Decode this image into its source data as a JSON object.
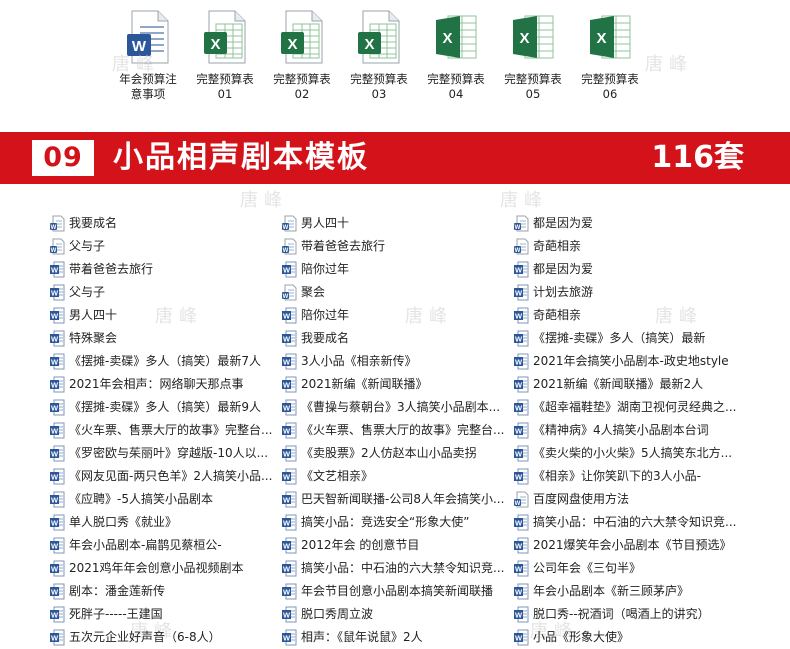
{
  "top_files": [
    {
      "label": "年会预算注\n意事项",
      "icon": "word-doc-icon"
    },
    {
      "label": "完整预算表\n01",
      "icon": "excel-old-icon"
    },
    {
      "label": "完整预算表\n02",
      "icon": "excel-old-icon"
    },
    {
      "label": "完整预算表\n03",
      "icon": "excel-old-icon"
    },
    {
      "label": "完整预算表\n04",
      "icon": "excel-new-icon"
    },
    {
      "label": "完整预算表\n05",
      "icon": "excel-new-icon"
    },
    {
      "label": "完整预算表\n06",
      "icon": "excel-new-icon"
    }
  ],
  "banner": {
    "number": "09",
    "title": "小品相声剧本模板",
    "count": "116套"
  },
  "colors": {
    "banner_red": "#d3121a",
    "word_blue": "#2b579a",
    "excel_green": "#217346"
  },
  "watermark": "唐峰",
  "columns": [
    [
      {
        "label": "我要成名",
        "icon": "word-old-icon"
      },
      {
        "label": "父与子",
        "icon": "word-old-icon"
      },
      {
        "label": "带着爸爸去旅行",
        "icon": "word-icon"
      },
      {
        "label": "父与子",
        "icon": "word-icon"
      },
      {
        "label": "男人四十",
        "icon": "word-icon"
      },
      {
        "label": "特殊聚会",
        "icon": "word-icon"
      },
      {
        "label": "《摆摊-卖碟》多人（搞笑）最新7人",
        "icon": "word-icon"
      },
      {
        "label": "2021年会相声：网络聊天那点事",
        "icon": "word-icon"
      },
      {
        "label": "《摆摊-卖碟》多人（搞笑）最新9人",
        "icon": "word-icon"
      },
      {
        "label": "《火车票、售票大厅的故事》完整台...",
        "icon": "word-icon"
      },
      {
        "label": "《罗密欧与茱丽叶》穿越版-10人以...",
        "icon": "word-icon"
      },
      {
        "label": "《网友见面-两只色羊》2人搞笑小品...",
        "icon": "word-icon"
      },
      {
        "label": "《应聘》-5人搞笑小品剧本",
        "icon": "word-icon"
      },
      {
        "label": "单人脱口秀《就业》",
        "icon": "word-icon"
      },
      {
        "label": "年会小品剧本-扁鹊见蔡桓公-",
        "icon": "word-icon"
      },
      {
        "label": "2021鸡年年会创意小品视频剧本",
        "icon": "word-icon"
      },
      {
        "label": "剧本：潘金莲新传",
        "icon": "word-icon"
      },
      {
        "label": "死胖子-----王建国",
        "icon": "word-icon"
      },
      {
        "label": "五次元企业好声音（6-8人）",
        "icon": "word-icon"
      }
    ],
    [
      {
        "label": "男人四十",
        "icon": "word-old-icon"
      },
      {
        "label": "带着爸爸去旅行",
        "icon": "word-old-icon"
      },
      {
        "label": "陪你过年",
        "icon": "word-icon"
      },
      {
        "label": "聚会",
        "icon": "word-old-icon"
      },
      {
        "label": "陪你过年",
        "icon": "word-icon"
      },
      {
        "label": "我要成名",
        "icon": "word-icon"
      },
      {
        "label": "3人小品《相亲新传》",
        "icon": "word-icon"
      },
      {
        "label": "2021新编《新闻联播》",
        "icon": "word-icon"
      },
      {
        "label": "《曹操与蔡朝台》3人搞笑小品剧本...",
        "icon": "word-icon"
      },
      {
        "label": "《火车票、售票大厅的故事》完整台...",
        "icon": "word-icon"
      },
      {
        "label": "《卖股票》2人仿赵本山小品卖拐",
        "icon": "word-icon"
      },
      {
        "label": "《文艺相亲》",
        "icon": "word-icon"
      },
      {
        "label": "巴天智新闻联播-公司8人年会搞笑小...",
        "icon": "word-icon"
      },
      {
        "label": "搞笑小品：竞选安全“形象大使”",
        "icon": "word-icon"
      },
      {
        "label": "2012年会               的创意节目",
        "icon": "word-icon"
      },
      {
        "label": "搞笑小品：中石油的六大禁令知识竞...",
        "icon": "word-icon"
      },
      {
        "label": "年会节目创意小品剧本搞笑新闻联播",
        "icon": "word-icon"
      },
      {
        "label": "脱口秀周立波",
        "icon": "word-icon"
      },
      {
        "label": "相声：《鼠年说鼠》2人",
        "icon": "word-icon"
      }
    ],
    [
      {
        "label": "都是因为爱",
        "icon": "word-old-icon"
      },
      {
        "label": "奇葩相亲",
        "icon": "word-old-icon"
      },
      {
        "label": "都是因为爱",
        "icon": "word-icon"
      },
      {
        "label": "计划去旅游",
        "icon": "word-icon"
      },
      {
        "label": "奇葩相亲",
        "icon": "word-icon"
      },
      {
        "label": "《摆摊-卖碟》多人（搞笑）最新",
        "icon": "word-icon"
      },
      {
        "label": "2021年会搞笑小品剧本-政史地style",
        "icon": "word-icon"
      },
      {
        "label": "2021新编《新闻联播》最新2人",
        "icon": "word-icon"
      },
      {
        "label": "《超幸福鞋垫》湖南卫视何灵经典之...",
        "icon": "word-icon"
      },
      {
        "label": "《精神病》4人搞笑小品剧本台词",
        "icon": "word-icon"
      },
      {
        "label": "《卖火柴的小火柴》5人搞笑东北方...",
        "icon": "word-icon"
      },
      {
        "label": "《相亲》让你笑趴下的3人小品-",
        "icon": "word-icon"
      },
      {
        "label": "百度网盘使用方法",
        "icon": "word-old-icon"
      },
      {
        "label": "搞笑小品：中石油的六大禁令知识竞...",
        "icon": "word-icon"
      },
      {
        "label": "2021爆笑年会小品剧本《节目预选》",
        "icon": "word-icon"
      },
      {
        "label": "公司年会《三句半》",
        "icon": "word-icon"
      },
      {
        "label": "年会小品剧本《新三顾茅庐》",
        "icon": "word-icon"
      },
      {
        "label": "脱口秀--祝酒词（喝酒上的讲究）",
        "icon": "word-icon"
      },
      {
        "label": "小品《形象大使》",
        "icon": "word-icon"
      }
    ]
  ]
}
